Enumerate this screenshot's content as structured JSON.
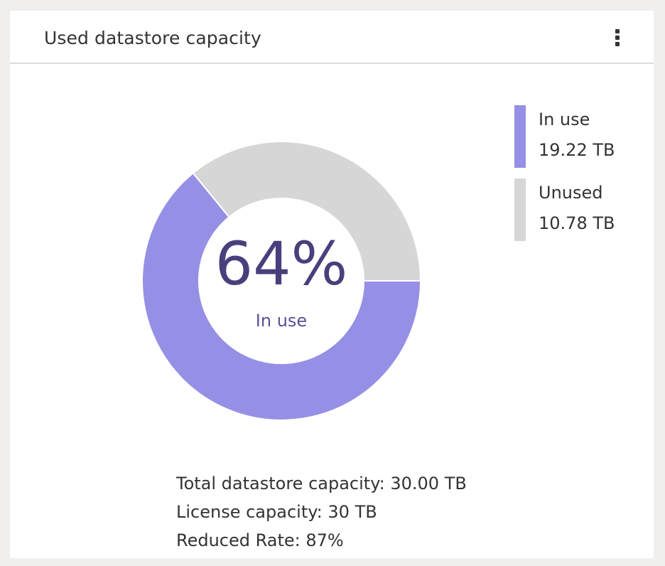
{
  "widget": {
    "title": "Used datastore capacity",
    "menu_icon": "vertical-ellipsis-icon"
  },
  "center": {
    "percent_text": "64%",
    "caption": "In use"
  },
  "legend": [
    {
      "label": "In use",
      "value": "19.22 TB",
      "color": "#9590e5"
    },
    {
      "label": "Unused",
      "value": "10.78 TB",
      "color": "#d6d6d6"
    }
  ],
  "stats": {
    "total": "Total datastore capacity: 30.00 TB",
    "license": "License capacity: 30 TB",
    "reduced": "Reduced Rate: 87%"
  },
  "chart_data": {
    "type": "pie",
    "donut": true,
    "categories": [
      "In use",
      "Unused"
    ],
    "values": [
      19.22,
      10.78
    ],
    "colors": [
      "#9590e5",
      "#d6d6d6"
    ],
    "unit": "TB",
    "title": "Used datastore capacity",
    "center_label": "64% In use",
    "legend_position": "top-right"
  }
}
